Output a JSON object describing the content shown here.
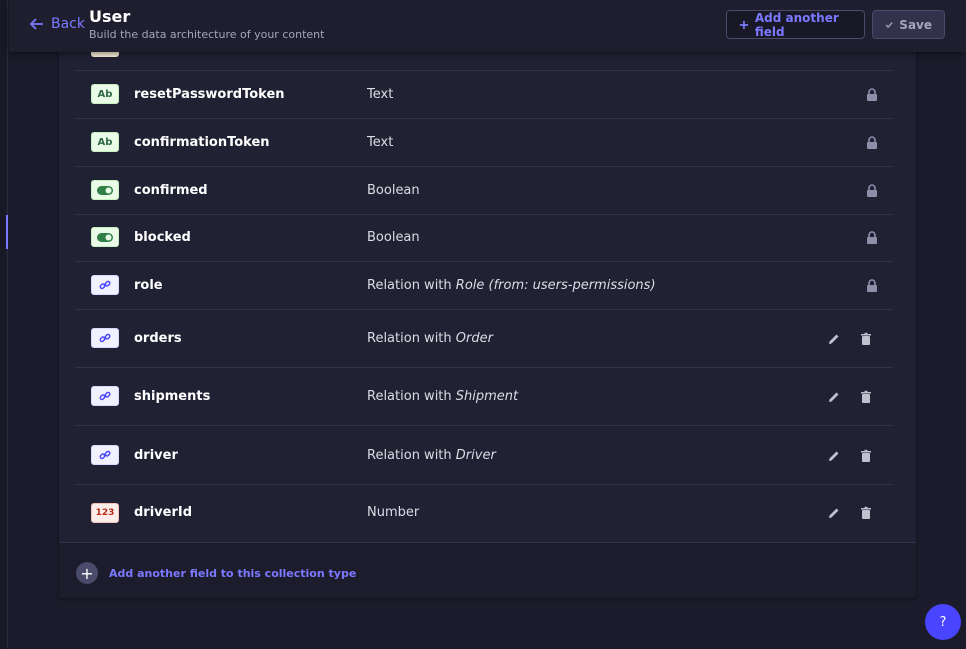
{
  "header": {
    "back_label": "Back",
    "title": "User",
    "subtitle": "Build the data architecture of your content",
    "add_field_label": "Add another field",
    "save_label": "Save"
  },
  "fields": [
    {
      "name": "resetPasswordToken",
      "type": "Text",
      "icon": "Ab",
      "kind": "text",
      "locked": true
    },
    {
      "name": "confirmationToken",
      "type": "Text",
      "icon": "Ab",
      "kind": "text",
      "locked": true
    },
    {
      "name": "confirmed",
      "type": "Boolean",
      "icon": "toggle-icon",
      "kind": "boolean",
      "locked": true
    },
    {
      "name": "blocked",
      "type": "Boolean",
      "icon": "toggle-icon",
      "kind": "boolean",
      "locked": true
    },
    {
      "name": "role",
      "type_prefix": "Relation with ",
      "type_target": "Role (from: users-permissions)",
      "icon": "link-icon",
      "kind": "relation",
      "locked": true
    },
    {
      "name": "orders",
      "type_prefix": "Relation with ",
      "type_target": "Order",
      "icon": "link-icon",
      "kind": "relation",
      "locked": false
    },
    {
      "name": "shipments",
      "type_prefix": "Relation with ",
      "type_target": "Shipment",
      "icon": "link-icon",
      "kind": "relation",
      "locked": false
    },
    {
      "name": "driver",
      "type_prefix": "Relation with ",
      "type_target": "Driver",
      "icon": "link-icon",
      "kind": "relation",
      "locked": false
    },
    {
      "name": "driverId",
      "type": "Number",
      "icon": "123",
      "kind": "number",
      "locked": false
    }
  ],
  "footer": {
    "add_field_label": "Add another field to this collection type"
  },
  "help": {
    "label": "?"
  },
  "colors": {
    "accent": "#7b79ff",
    "primary": "#4945ff",
    "background": "#1b1b2b",
    "card": "#212134"
  }
}
